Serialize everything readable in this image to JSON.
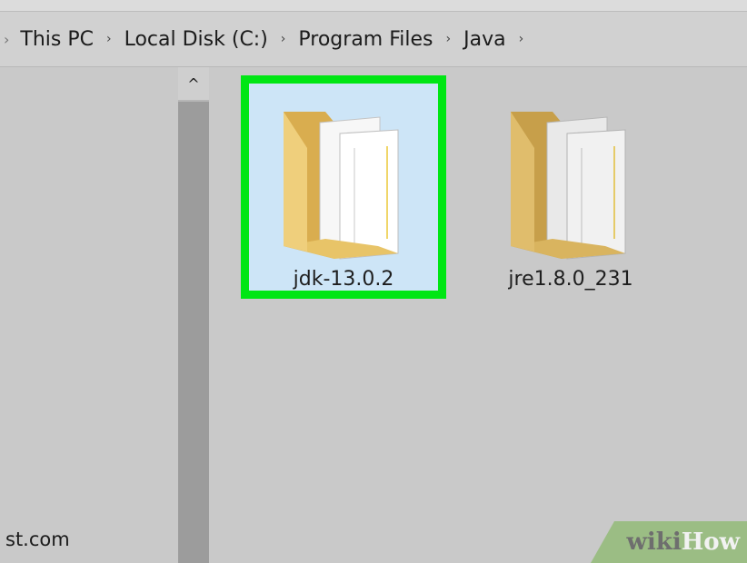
{
  "breadcrumb": {
    "items": [
      "This PC",
      "Local Disk (C:)",
      "Program Files",
      "Java"
    ],
    "separator": "›"
  },
  "nav_pane": {
    "partial_text": "st.com"
  },
  "scrollbar": {
    "up_arrow": "^"
  },
  "files": [
    {
      "name": "jdk-13.0.2",
      "icon": "folder-icon",
      "selected": true
    },
    {
      "name": "jre1.8.0_231",
      "icon": "folder-icon",
      "selected": false
    }
  ],
  "watermark": {
    "part1": "wiki",
    "part2": "How"
  },
  "colors": {
    "selection_border": "#00e614",
    "selection_fill": "#cde5f7",
    "folder": "#e6c26e"
  }
}
